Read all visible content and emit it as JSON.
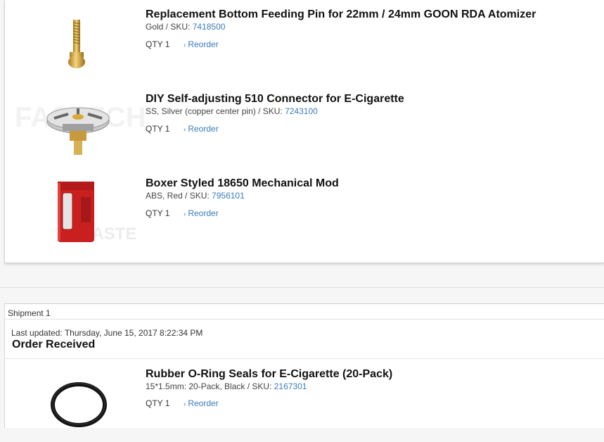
{
  "order_items": [
    {
      "title": "Replacement Bottom Feeding Pin for 22mm / 24mm GOON RDA Atomizer",
      "variant": "Gold / SKU: ",
      "sku": "7418500",
      "qty": "QTY 1",
      "reorder": "Reorder",
      "thumb": "gold-pin"
    },
    {
      "title": "DIY Self-adjusting 510 Connector for E-Cigarette",
      "variant": "SS, Silver (copper center pin) / SKU: ",
      "sku": "7243100",
      "qty": "QTY 1",
      "reorder": "Reorder",
      "thumb": "510-connector"
    },
    {
      "title": "Boxer Styled 18650 Mechanical Mod",
      "variant": "ABS, Red / SKU: ",
      "sku": "7956101",
      "qty": "QTY 1",
      "reorder": "Reorder",
      "thumb": "red-box-mod"
    }
  ],
  "shipment": {
    "label": "Shipment 1",
    "last_updated": "Last updated: Thursday, June 15, 2017 8:22:34 PM",
    "status": "Order Received",
    "items": [
      {
        "title": "Rubber O-Ring Seals for E-Cigarette (20-Pack)",
        "variant": "15*1.5mm: 20-Pack, Black / SKU: ",
        "sku": "2167301",
        "qty": "QTY 1",
        "reorder": "Reorder",
        "thumb": "black-o-ring"
      }
    ]
  },
  "colors": {
    "link": "#3a7bbf",
    "mod_red": "#c9201f",
    "gold": "#d9a93a"
  }
}
